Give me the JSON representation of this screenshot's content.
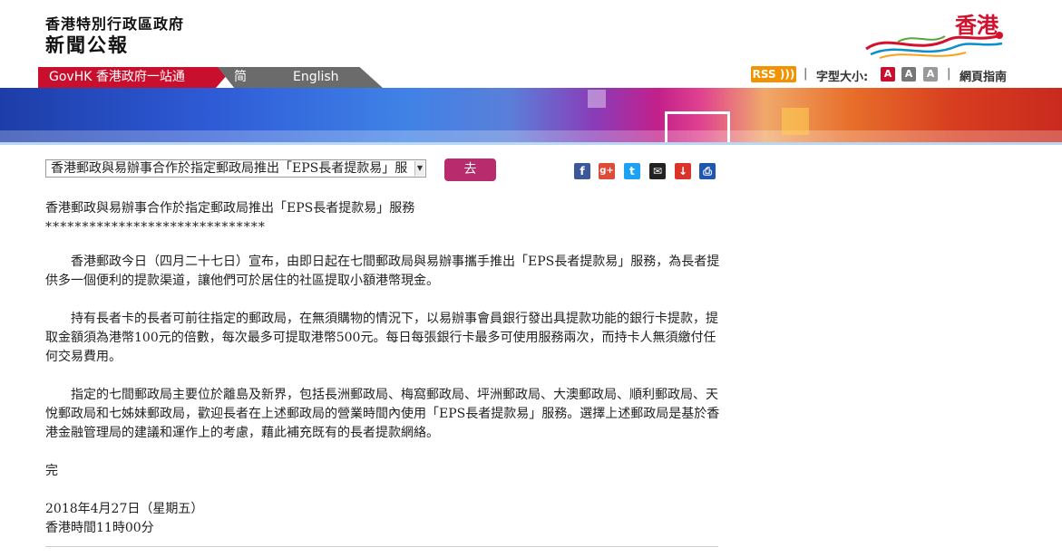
{
  "header": {
    "gov_name": "香港特別行政區政府",
    "section_title": "新聞公報",
    "brand_logo_text": "香港"
  },
  "nav": {
    "govhk": "GovHK 香港政府一站通",
    "simplified": "简体版",
    "english": "English"
  },
  "utility": {
    "rss": "RSS",
    "font_size_label": "字型大小:",
    "font_sizes": [
      "A",
      "A",
      "A"
    ],
    "guide": "網頁指南"
  },
  "selector": {
    "selected": "香港郵政與易辦事合作於指定郵政局推出「EPS長者提款易」服",
    "go": "去"
  },
  "share_icons": [
    "facebook-icon",
    "google-plus-icon",
    "twitter-icon",
    "email-icon",
    "bookmark-icon",
    "print-icon"
  ],
  "article": {
    "headline": "香港郵政與易辦事合作於指定郵政局推出「EPS長者提款易」服務",
    "stars": "******************************",
    "para1": "香港郵政今日（四月二十七日）宣布，由即日起在七間郵政局與易辦事攜手推出「EPS長者提款易」服務，為長者提供多一個便利的提款渠道，讓他們可於居住的社區提取小額港幣現金。",
    "para2": "持有長者卡的長者可前往指定的郵政局，在無須購物的情況下，以易辦事會員銀行發出具提款功能的銀行卡提款，提取金額須為港幣100元的倍數，每次最多可提取港幣500元。每日每張銀行卡最多可使用服務兩次，而持卡人無須繳付任何交易費用。",
    "para3": "指定的七間郵政局主要位於離島及新界，包括長洲郵政局、梅窩郵政局、坪洲郵政局、大澳郵政局、順利郵政局、天悅郵政局和七姊妹郵政局，歡迎長者在上述郵政局的營業時間內使用「EPS長者提款易」服務。選擇上述郵政局是基於香港金融管理局的建議和運作上的考慮，藉此補充既有的長者提款網絡。",
    "end": "完",
    "date": "2018年4月27日（星期五）",
    "time": "香港時間11時00分"
  },
  "colors": {
    "govhk_red": "#c8102e",
    "rss_orange": "#f39200",
    "go_button": "#b82c6e",
    "font_size_buttons": [
      "#c8102e",
      "#777777",
      "#999999"
    ]
  }
}
